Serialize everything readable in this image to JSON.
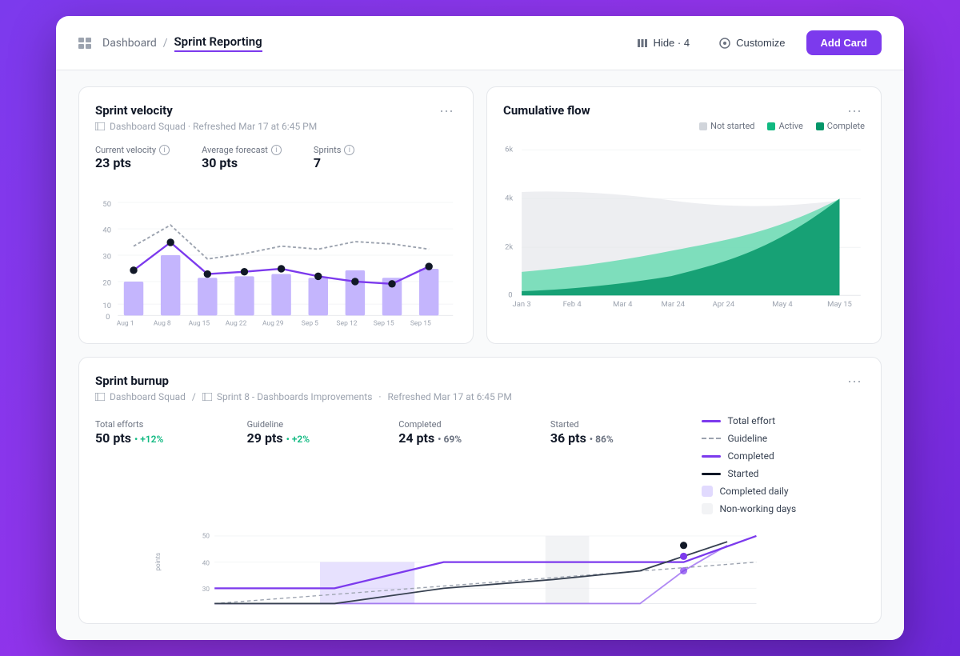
{
  "header": {
    "breadcrumb_icon": "grid-icon",
    "breadcrumb_parent": "Dashboard",
    "breadcrumb_separator": "/",
    "breadcrumb_current": "Sprint Reporting",
    "hide_label": "Hide · 4",
    "customize_label": "Customize",
    "add_card_label": "Add Card"
  },
  "sprint_velocity": {
    "title": "Sprint velocity",
    "subtitle": "Dashboard Squad · Refreshed Mar 17 at 6:45 PM",
    "stats": [
      {
        "label": "Current velocity",
        "value": "23 pts"
      },
      {
        "label": "Average forecast",
        "value": "30 pts"
      },
      {
        "label": "Sprints",
        "value": "7"
      }
    ],
    "x_labels": [
      "Aug 1",
      "Aug 8",
      "Aug 15",
      "Aug 22",
      "Aug 29",
      "Sep 5",
      "Sep 12",
      "Sep 15",
      "Sep 15"
    ]
  },
  "cumulative_flow": {
    "title": "Cumulative flow",
    "legend": [
      {
        "label": "Not started",
        "color": "#d1d5db"
      },
      {
        "label": "Active",
        "color": "#10b981"
      },
      {
        "label": "Complete",
        "color": "#059669"
      }
    ],
    "y_labels": [
      "6k",
      "4k",
      "2k",
      "0"
    ],
    "x_labels": [
      "Jan 3",
      "Feb 4",
      "Mar 4",
      "Mar 24",
      "Apr 24",
      "May 4",
      "May 15"
    ]
  },
  "sprint_burnup": {
    "title": "Sprint burnup",
    "subtitle_team": "Dashboard Squad",
    "subtitle_sprint": "Sprint 8 - Dashboards Improvements",
    "subtitle_refresh": "Refreshed Mar 17 at 6:45 PM",
    "stats": [
      {
        "label": "Total efforts",
        "value": "50 pts",
        "badge": "+12%",
        "badge_type": "green"
      },
      {
        "label": "Guideline",
        "value": "29 pts",
        "badge": "+2%",
        "badge_type": "green"
      },
      {
        "label": "Completed",
        "value": "24 pts",
        "badge": "69%",
        "badge_type": "neutral"
      },
      {
        "label": "Started",
        "value": "36 pts",
        "badge": "86%",
        "badge_type": "neutral"
      }
    ],
    "legend": [
      {
        "label": "Total effort",
        "type": "solid",
        "color": "#7c3aed"
      },
      {
        "label": "Guideline",
        "type": "dashed",
        "color": "#9ca3af"
      },
      {
        "label": "Completed",
        "type": "solid",
        "color": "#7c3aed"
      },
      {
        "label": "Started",
        "type": "solid",
        "color": "#111827"
      },
      {
        "label": "Completed daily",
        "type": "box",
        "color": "#c4b5fd"
      },
      {
        "label": "Non-working days",
        "type": "box",
        "color": "#e5e7eb"
      }
    ]
  }
}
